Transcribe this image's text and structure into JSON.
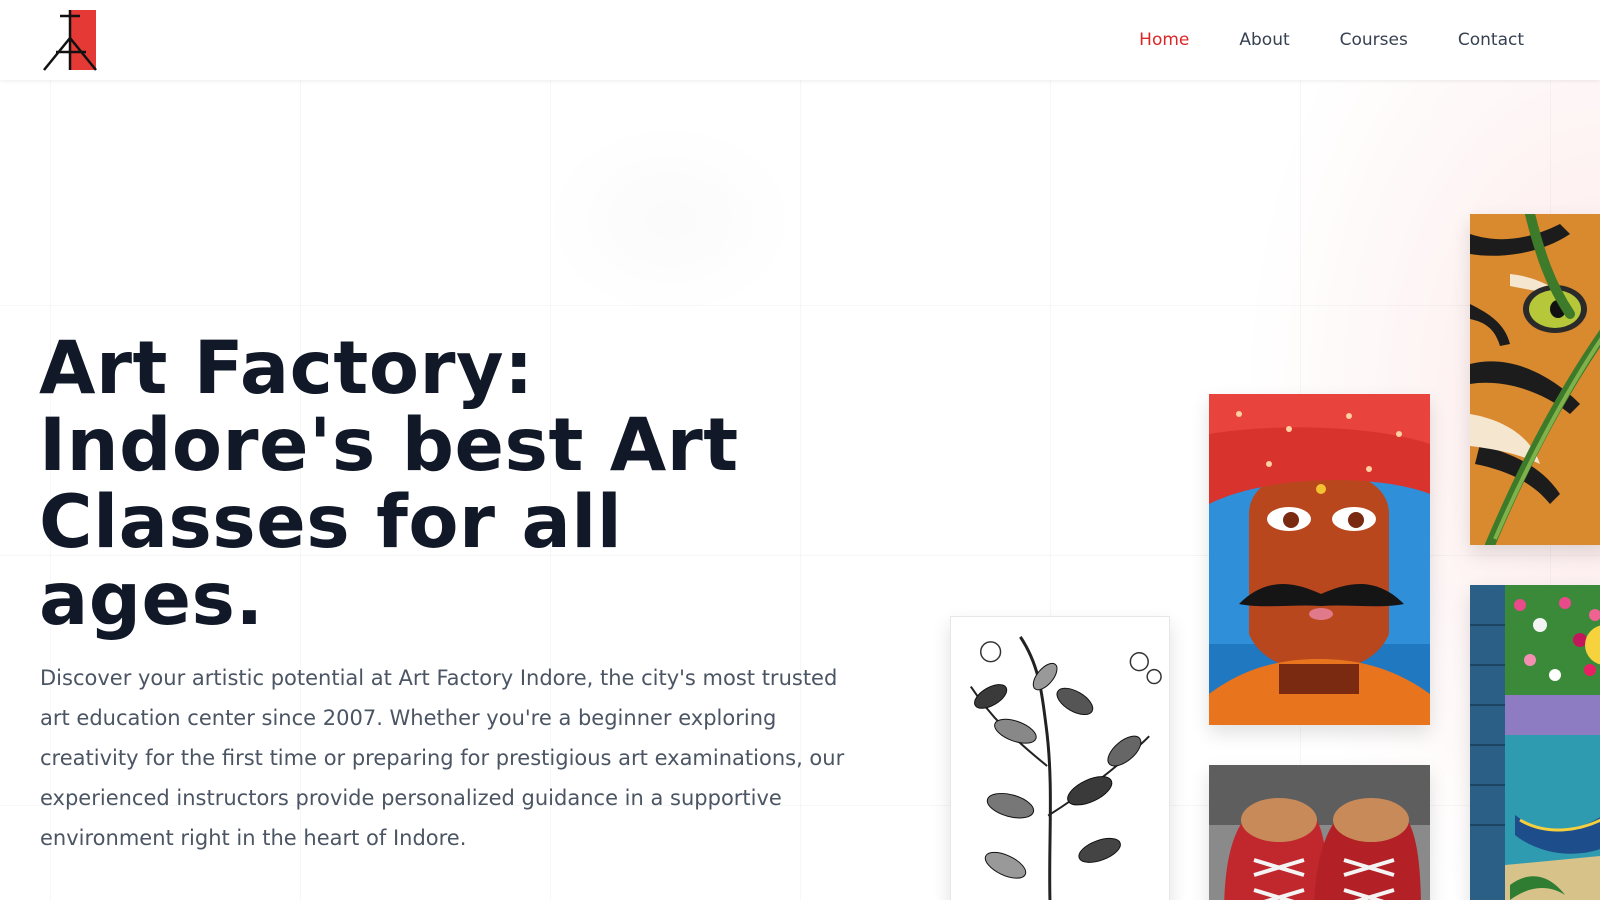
{
  "header": {
    "logo": {
      "icon": "easel-logo-icon",
      "accent": "#e53935"
    },
    "nav": [
      {
        "label": "Home",
        "active": true
      },
      {
        "label": "About",
        "active": false
      },
      {
        "label": "Courses",
        "active": false
      },
      {
        "label": "Contact",
        "active": false
      }
    ]
  },
  "hero": {
    "title": "Art Factory: Indore's best Art Classes for all ages.",
    "description": "Discover your artistic potential at Art Factory Indore, the city's most trusted art education center since 2007. Whether you're a beginner exploring creativity for the first time or preparing for prestigious art examinations, our experienced instructors provide personalized guidance in a supportive environment right in the heart of Indore."
  },
  "gallery": [
    {
      "name": "plant-sketch-artwork",
      "icon": "botanical-sketch-image"
    },
    {
      "name": "turban-portrait-artwork",
      "icon": "rajasthani-portrait-image"
    },
    {
      "name": "sneakers-artwork",
      "icon": "red-sneakers-image"
    },
    {
      "name": "tiger-artwork",
      "icon": "tiger-eye-image"
    },
    {
      "name": "boat-landscape-artwork",
      "icon": "boat-flowers-image"
    }
  ],
  "colors": {
    "accent": "#dc2626",
    "heading": "#111827",
    "body_text": "#4b5563",
    "nav_text": "#374151"
  }
}
